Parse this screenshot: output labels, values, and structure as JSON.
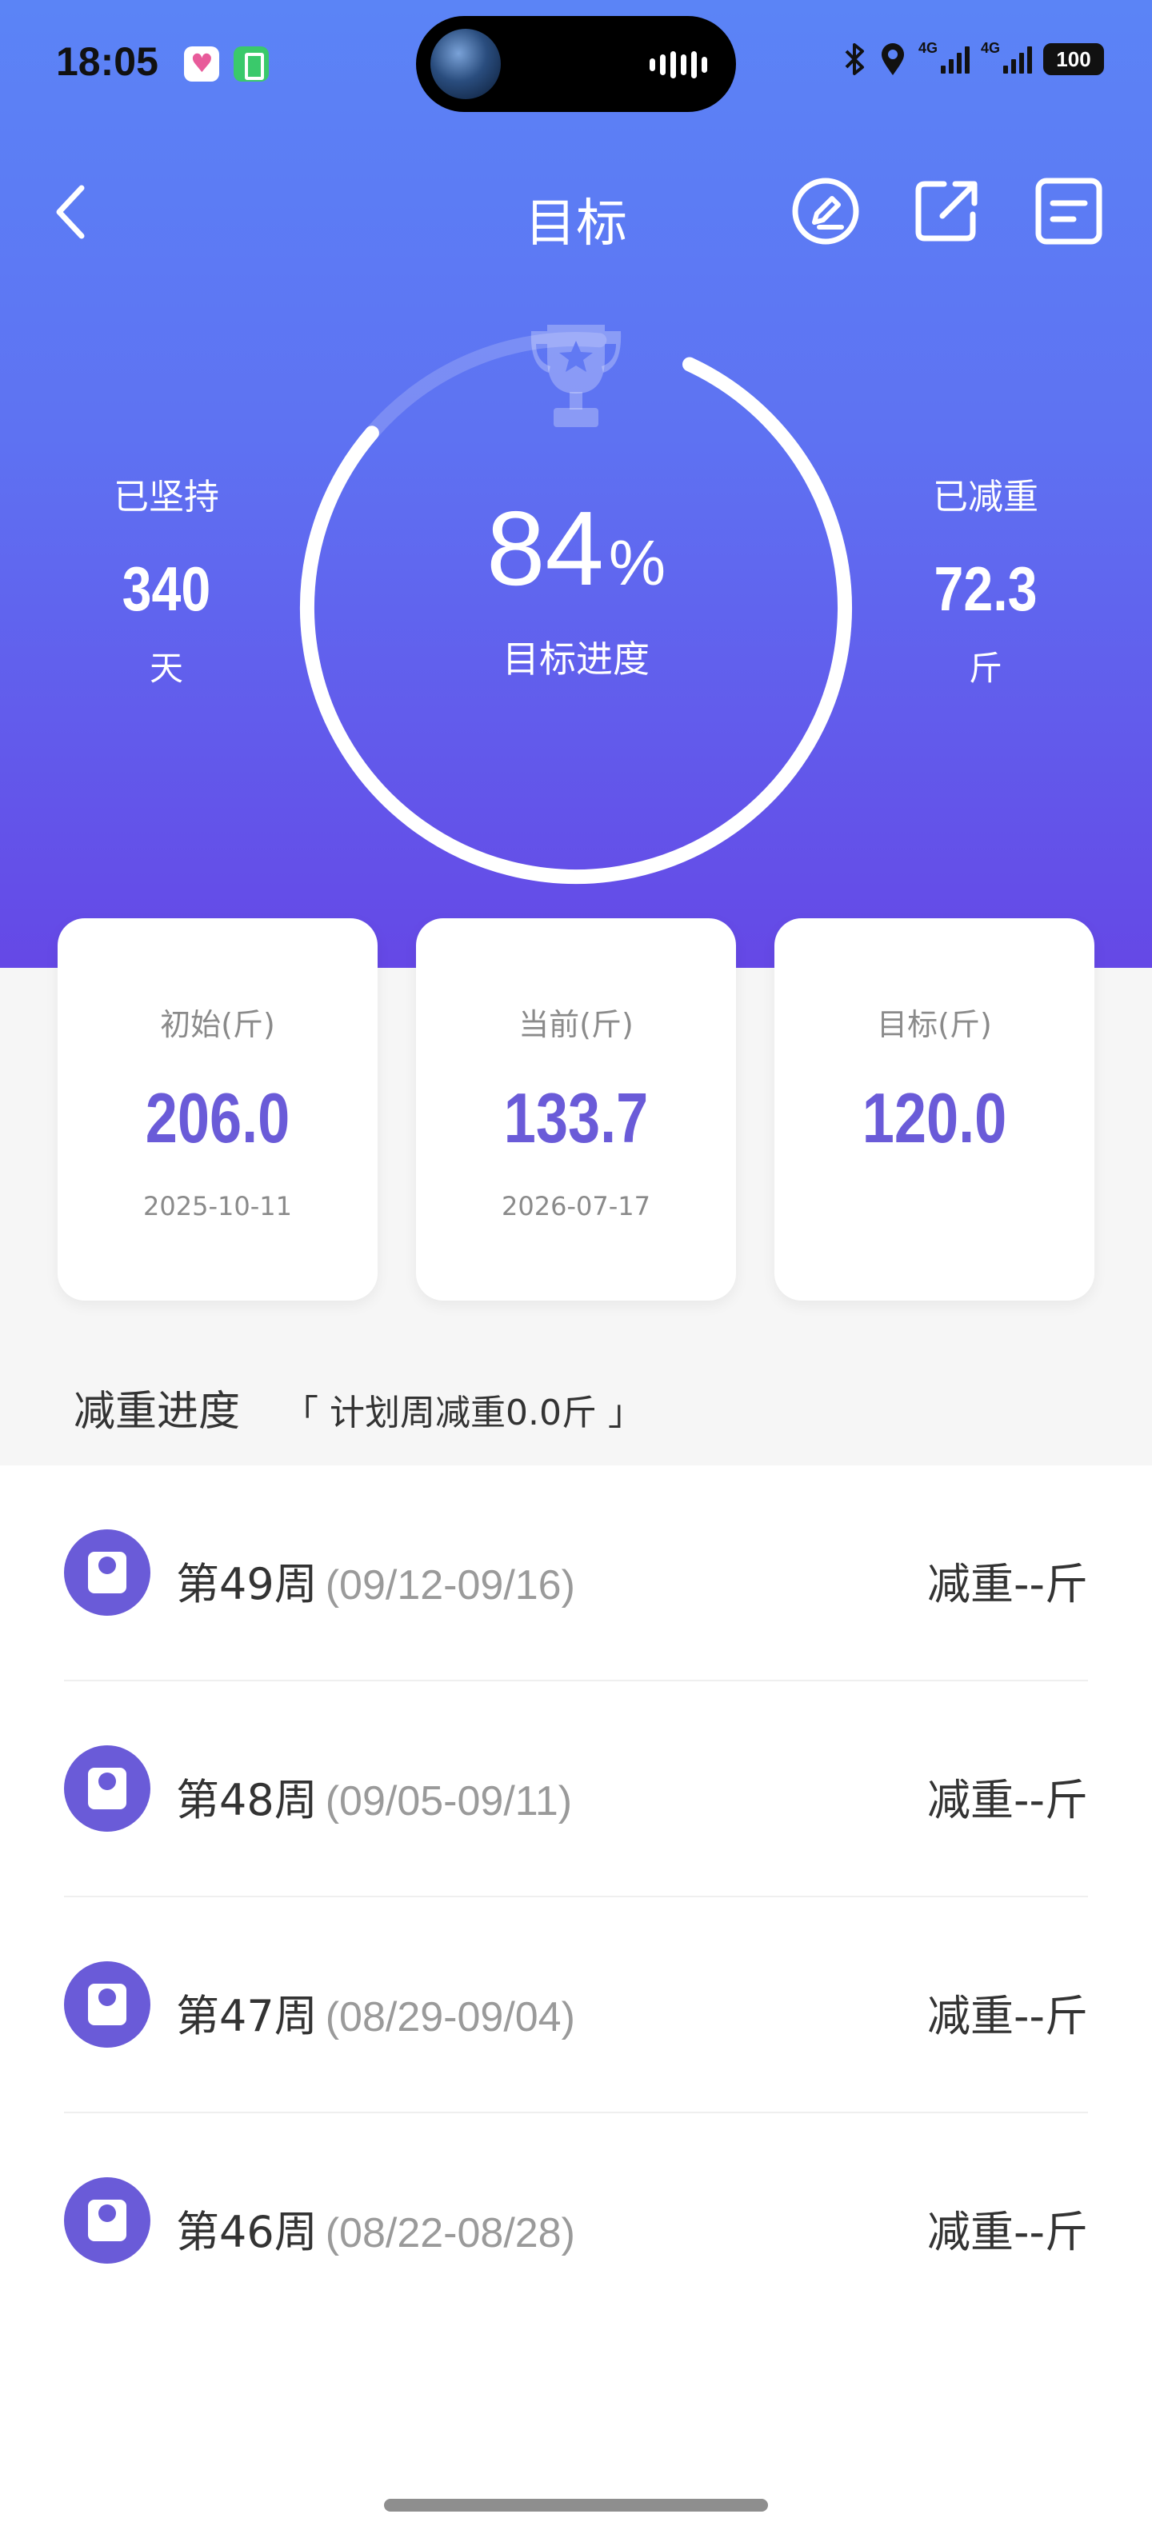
{
  "status_bar": {
    "time": "18:05",
    "battery": "100",
    "network_1": "4G",
    "network_2": "4G",
    "icons": [
      "bluetooth-icon",
      "location-icon",
      "signal-icon",
      "battery-icon"
    ]
  },
  "nav": {
    "title": "目标",
    "icons": [
      "back-icon",
      "edit-icon",
      "share-icon",
      "list-icon"
    ]
  },
  "progress": {
    "percent_value": "84",
    "percent_unit": "%",
    "fraction": 0.84,
    "label": "目标进度"
  },
  "left_stat": {
    "label": "已坚持",
    "value": "340",
    "unit": "天"
  },
  "right_stat": {
    "label": "已减重",
    "value": "72.3",
    "unit": "斤"
  },
  "cards": [
    {
      "label": "初始(斤)",
      "value": "206.0",
      "date": "2025-10-11"
    },
    {
      "label": "当前(斤)",
      "value": "133.7",
      "date": "2026-07-17"
    },
    {
      "label": "目标(斤)",
      "value": "120.0",
      "date": ""
    }
  ],
  "section": {
    "title": "减重进度",
    "subtitle": "「 计划周减重0.0斤 」"
  },
  "weeks": [
    {
      "name": "第49周",
      "range": "(09/12-09/16)",
      "loss": "减重--斤"
    },
    {
      "name": "第48周",
      "range": "(09/05-09/11)",
      "loss": "减重--斤"
    },
    {
      "name": "第47周",
      "range": "(08/29-09/04)",
      "loss": "减重--斤"
    },
    {
      "name": "第46周",
      "range": "(08/22-08/28)",
      "loss": "减重--斤"
    }
  ],
  "colors": {
    "gradient_top": "#5b84f6",
    "gradient_bottom": "#6548e6",
    "accent": "#6a5bd8",
    "ring": "#ffffff"
  }
}
